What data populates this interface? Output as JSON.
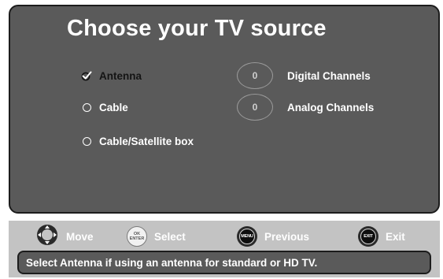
{
  "screen": {
    "title": "Choose your TV source"
  },
  "sources": [
    {
      "label": "Antenna",
      "selected": true
    },
    {
      "label": "Cable",
      "selected": false
    },
    {
      "label": "Cable/Satellite box",
      "selected": false
    }
  ],
  "channel_counts": [
    {
      "value": "0",
      "label": "Digital Channels"
    },
    {
      "value": "0",
      "label": "Analog Channels"
    }
  ],
  "help": {
    "move_label": "Move",
    "select_label": "Select",
    "select_key_top": "OK",
    "select_key_bottom": "ENTER",
    "previous_label": "Previous",
    "previous_key": "MENU",
    "exit_label": "Exit",
    "exit_key": "EXIT",
    "status": "Select Antenna if using an antenna for standard or HD TV."
  },
  "icons": {
    "checkmark": "check-icon",
    "radio": "radio-circle-icon",
    "dpad": "dpad-icon"
  }
}
